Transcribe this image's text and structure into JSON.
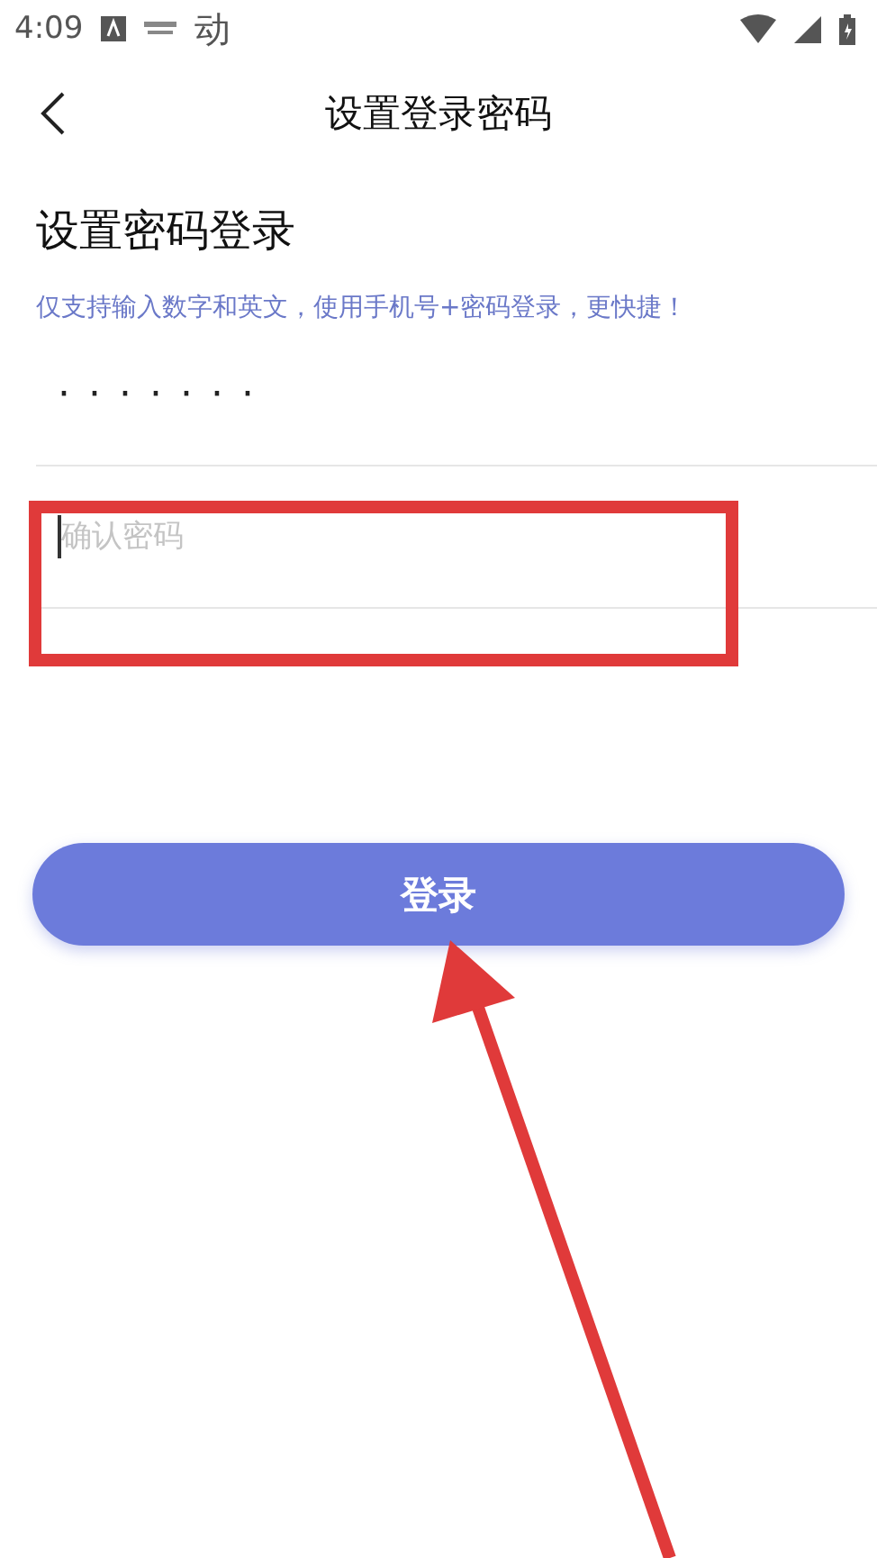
{
  "status_bar": {
    "time": "4:09",
    "app_glyph": "动"
  },
  "header": {
    "title": "设置登录密码"
  },
  "heading": "设置密码登录",
  "hint": "仅支持输入数字和英文，使用手机号+密码登录，更快捷！",
  "fields": [
    {
      "kind": "password",
      "value": "·······"
    },
    {
      "kind": "confirm",
      "placeholder": "确认密码",
      "focused": true
    }
  ],
  "login_button": "登录",
  "annotation": {
    "highlight": true,
    "arrow": true
  }
}
